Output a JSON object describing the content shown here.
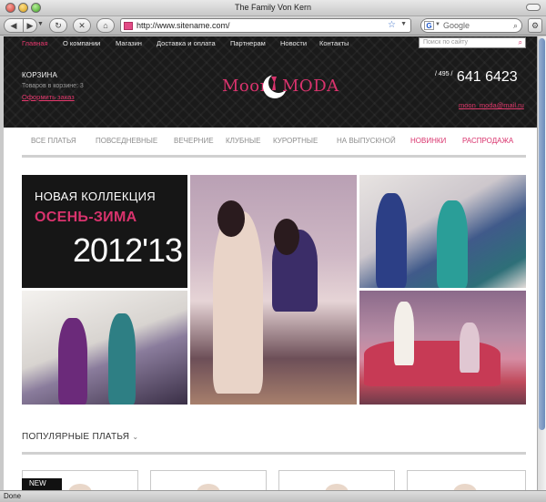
{
  "browser": {
    "window_title": "The Family Von Kern",
    "url": "http://www.sitename.com/",
    "search_placeholder": "Google",
    "google_glyph": "G",
    "status": "Done"
  },
  "header": {
    "nav": [
      "Главная",
      "О компании",
      "Магазин",
      "Доставка и оплата",
      "Партнерам",
      "Новости",
      "Контакты"
    ],
    "site_search_placeholder": "Поиск по сайту",
    "cart_title": "КОРЗИНА",
    "cart_count": "Товаров в корзине: 3",
    "checkout_link": "Оформить заказ",
    "logo_left": "Moon",
    "logo_right": "MODA",
    "phone_prefix": "/ 495 /",
    "phone_number": "641 6423",
    "email": "moon_moda@mail.ru"
  },
  "catalog": {
    "items": [
      "ВСЕ ПЛАТЬЯ",
      "ПОВСЕДНЕВНЫЕ",
      "ВЕЧЕРНИЕ",
      "КЛУБНЫЕ",
      "КУРОРТНЫЕ",
      "НА ВЫПУСКНОЙ",
      "НОВИНКИ",
      "РАСПРОДАЖА"
    ]
  },
  "banner": {
    "line1": "НОВАЯ КОЛЛЕКЦИЯ",
    "line2": "ОСЕНЬ-ЗИМА",
    "line3": "2012'13"
  },
  "popular": {
    "title": "ПОПУЛЯРНЫЕ ПЛАТЬЯ",
    "badge": "NEW"
  },
  "colors": {
    "accent": "#d9336d",
    "header_bg": "#1a1a1a"
  },
  "icons": [
    "back-icon",
    "forward-icon",
    "reload-icon",
    "stop-icon",
    "home-icon",
    "star-icon",
    "search-icon",
    "gear-icon",
    "moon-logo-icon",
    "chevron-down-icon"
  ]
}
